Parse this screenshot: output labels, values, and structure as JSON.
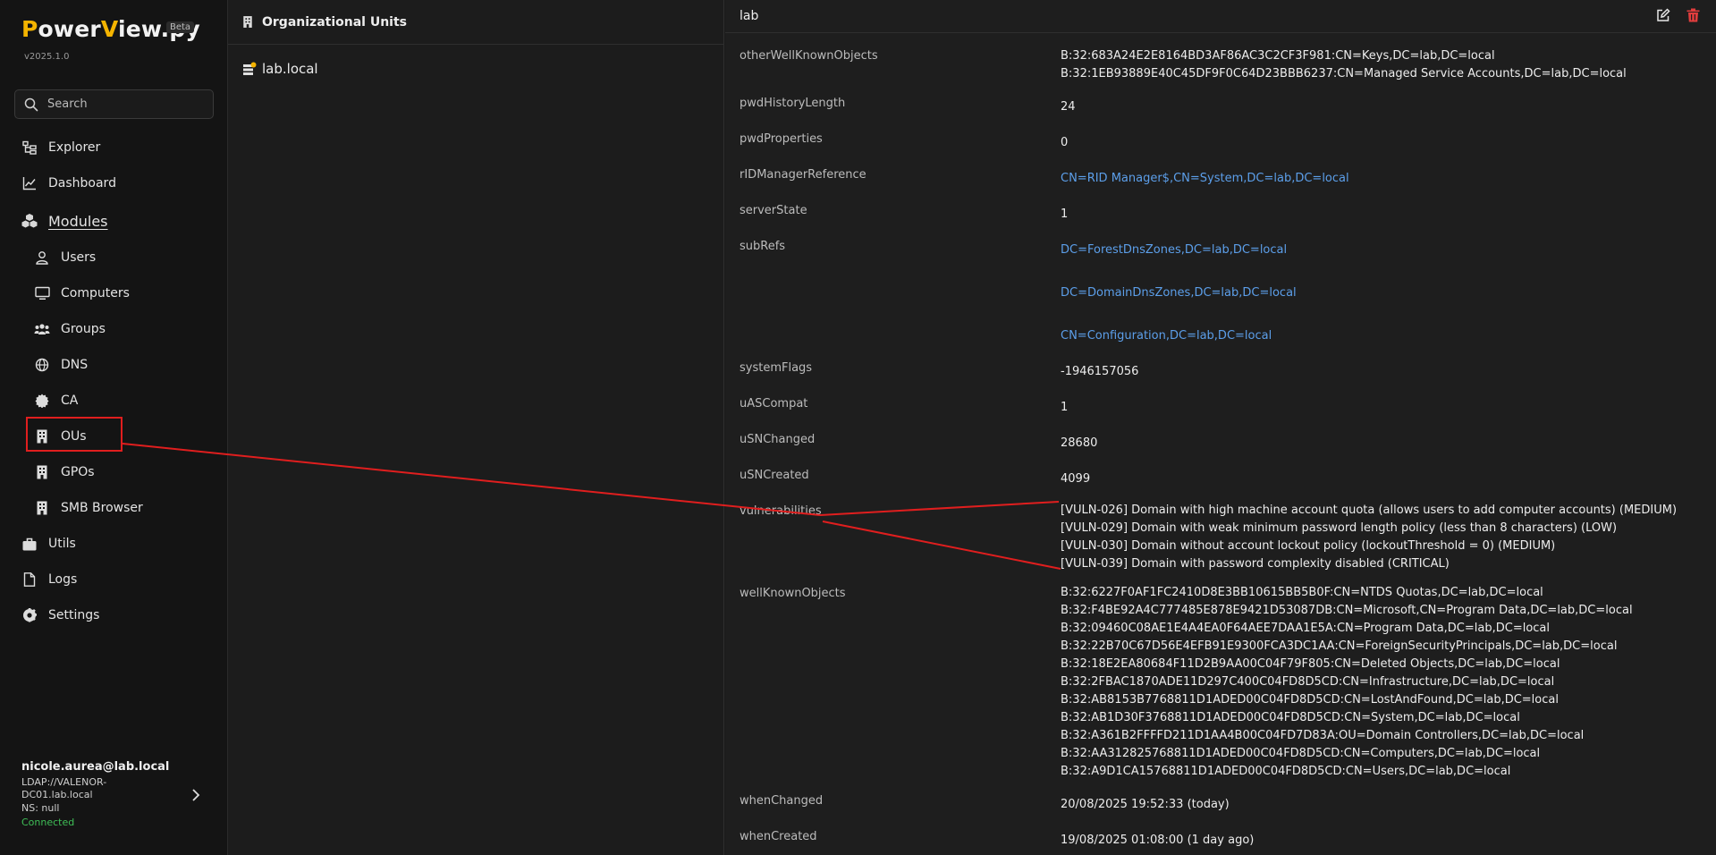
{
  "app": {
    "logo_p": "P",
    "logo_ower": "ower",
    "logo_v": "V",
    "logo_rest": "iew.py",
    "beta": "Beta",
    "version": "v2025.1.0"
  },
  "search": {
    "placeholder": "Search"
  },
  "nav": {
    "explorer": "Explorer",
    "dashboard": "Dashboard",
    "modules": "Modules",
    "users": "Users",
    "computers": "Computers",
    "groups": "Groups",
    "dns": "DNS",
    "ca": "CA",
    "ous": "OUs",
    "gpos": "GPOs",
    "smb": "SMB Browser",
    "utils": "Utils",
    "logs": "Logs",
    "settings": "Settings"
  },
  "user": {
    "email": "nicole.aurea@lab.local",
    "ldap": "LDAP://VALENOR-DC01.lab.local",
    "ns": "NS: null",
    "status": "Connected"
  },
  "ou_panel": {
    "title": "Organizational Units",
    "item": "lab.local"
  },
  "details": {
    "title": "lab",
    "props": {
      "otherWellKnownObjects": {
        "label": "otherWellKnownObjects",
        "values": [
          "B:32:683A24E2E8164BD3AF86AC3C2CF3F981:CN=Keys,DC=lab,DC=local",
          "B:32:1EB93889E40C45DF9F0C64D23BBB6237:CN=Managed Service Accounts,DC=lab,DC=local"
        ]
      },
      "pwdHistoryLength": {
        "label": "pwdHistoryLength",
        "value": "24"
      },
      "pwdProperties": {
        "label": "pwdProperties",
        "value": "0"
      },
      "rIDManagerReference": {
        "label": "rIDManagerReference",
        "value": "CN=RID Manager$,CN=System,DC=lab,DC=local"
      },
      "serverState": {
        "label": "serverState",
        "value": "1"
      },
      "subRefs": {
        "label": "subRefs",
        "values": [
          "DC=ForestDnsZones,DC=lab,DC=local",
          "DC=DomainDnsZones,DC=lab,DC=local",
          "CN=Configuration,DC=lab,DC=local"
        ]
      },
      "systemFlags": {
        "label": "systemFlags",
        "value": "-1946157056"
      },
      "uASCompat": {
        "label": "uASCompat",
        "value": "1"
      },
      "uSNChanged": {
        "label": "uSNChanged",
        "value": "28680"
      },
      "uSNCreated": {
        "label": "uSNCreated",
        "value": "4099"
      },
      "vulnerabilities": {
        "label": "vulnerabilities",
        "values": [
          "[VULN-026] Domain with high machine account quota (allows users to add computer accounts) (MEDIUM)",
          "[VULN-029] Domain with weak minimum password length policy (less than 8 characters) (LOW)",
          "[VULN-030] Domain without account lockout policy (lockoutThreshold = 0) (MEDIUM)",
          "[VULN-039] Domain with password complexity disabled (CRITICAL)"
        ]
      },
      "wellKnownObjects": {
        "label": "wellKnownObjects",
        "values": [
          "B:32:6227F0AF1FC2410D8E3BB10615BB5B0F:CN=NTDS Quotas,DC=lab,DC=local",
          "B:32:F4BE92A4C777485E878E9421D53087DB:CN=Microsoft,CN=Program Data,DC=lab,DC=local",
          "B:32:09460C08AE1E4A4EA0F64AEE7DAA1E5A:CN=Program Data,DC=lab,DC=local",
          "B:32:22B70C67D56E4EFB91E9300FCA3DC1AA:CN=ForeignSecurityPrincipals,DC=lab,DC=local",
          "B:32:18E2EA80684F11D2B9AA00C04F79F805:CN=Deleted Objects,DC=lab,DC=local",
          "B:32:2FBAC1870ADE11D297C400C04FD8D5CD:CN=Infrastructure,DC=lab,DC=local",
          "B:32:AB8153B7768811D1ADED00C04FD8D5CD:CN=LostAndFound,DC=lab,DC=local",
          "B:32:AB1D30F3768811D1ADED00C04FD8D5CD:CN=System,DC=lab,DC=local",
          "B:32:A361B2FFFFD211D1AA4B00C04FD7D83A:OU=Domain Controllers,DC=lab,DC=local",
          "B:32:AA312825768811D1ADED00C04FD8D5CD:CN=Computers,DC=lab,DC=local",
          "B:32:A9D1CA15768811D1ADED00C04FD8D5CD:CN=Users,DC=lab,DC=local"
        ]
      },
      "whenChanged": {
        "label": "whenChanged",
        "value": "20/08/2025 19:52:33 (today)"
      },
      "whenCreated": {
        "label": "whenCreated",
        "value": "19/08/2025 01:08:00 (1 day ago)"
      }
    }
  },
  "colors": {
    "accent": "#f4b400",
    "link": "#5c9fea",
    "annotation": "#e01e1e",
    "connected": "#3fbf57"
  }
}
